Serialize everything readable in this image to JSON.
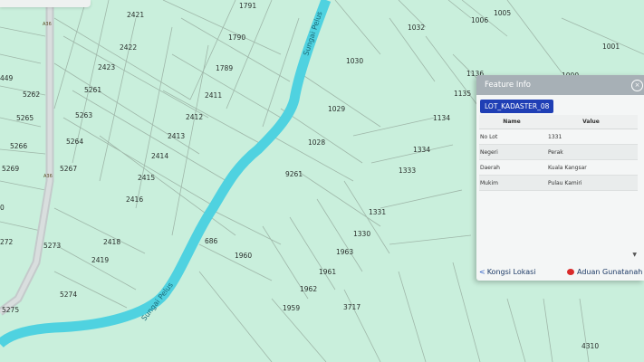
{
  "map": {
    "river_name": "Sungai Pelus",
    "road_label": "A36",
    "lots": [
      "2421",
      "1791",
      "1790",
      "2422",
      "2423",
      "1789",
      "5261",
      "5262",
      "449",
      "2411",
      "2412",
      "5263",
      "5265",
      "2413",
      "5264",
      "5266",
      "2414",
      "5267",
      "5269",
      "2415",
      "2416",
      "272",
      "5273",
      "2418",
      "2419",
      "686",
      "1960",
      "5274",
      "5275",
      "1032",
      "1006",
      "1005",
      "1001",
      "1030",
      "1000",
      "1136",
      "1135",
      "1029",
      "1134",
      "1028",
      "1334",
      "9261",
      "1333",
      "1331",
      "1330",
      "1963",
      "1961",
      "1962",
      "1959",
      "3717",
      "0",
      "4310"
    ]
  },
  "panel": {
    "title": "Feature Info",
    "close_label": "×",
    "layer_name": "LOT_KADASTER_08",
    "col_name": "Name",
    "col_value": "Value",
    "rows": [
      {
        "name": "No Lot",
        "value": "1331"
      },
      {
        "name": "Negeri",
        "value": "Perak"
      },
      {
        "name": "Daerah",
        "value": "Kuala Kangsar"
      },
      {
        "name": "Mukim",
        "value": "Pulau Kamiri"
      }
    ],
    "share_label": "Kongsi Lokasi",
    "report_label": "Aduan Gunatanah",
    "share_icon": "share-icon",
    "report_icon": "chat-icon"
  },
  "colors": {
    "land": "#c9efdc",
    "river": "#4fd2e0",
    "road": "#b8bfc0",
    "panel_header": "#a7b0b6",
    "badge": "#1f3fb5"
  }
}
